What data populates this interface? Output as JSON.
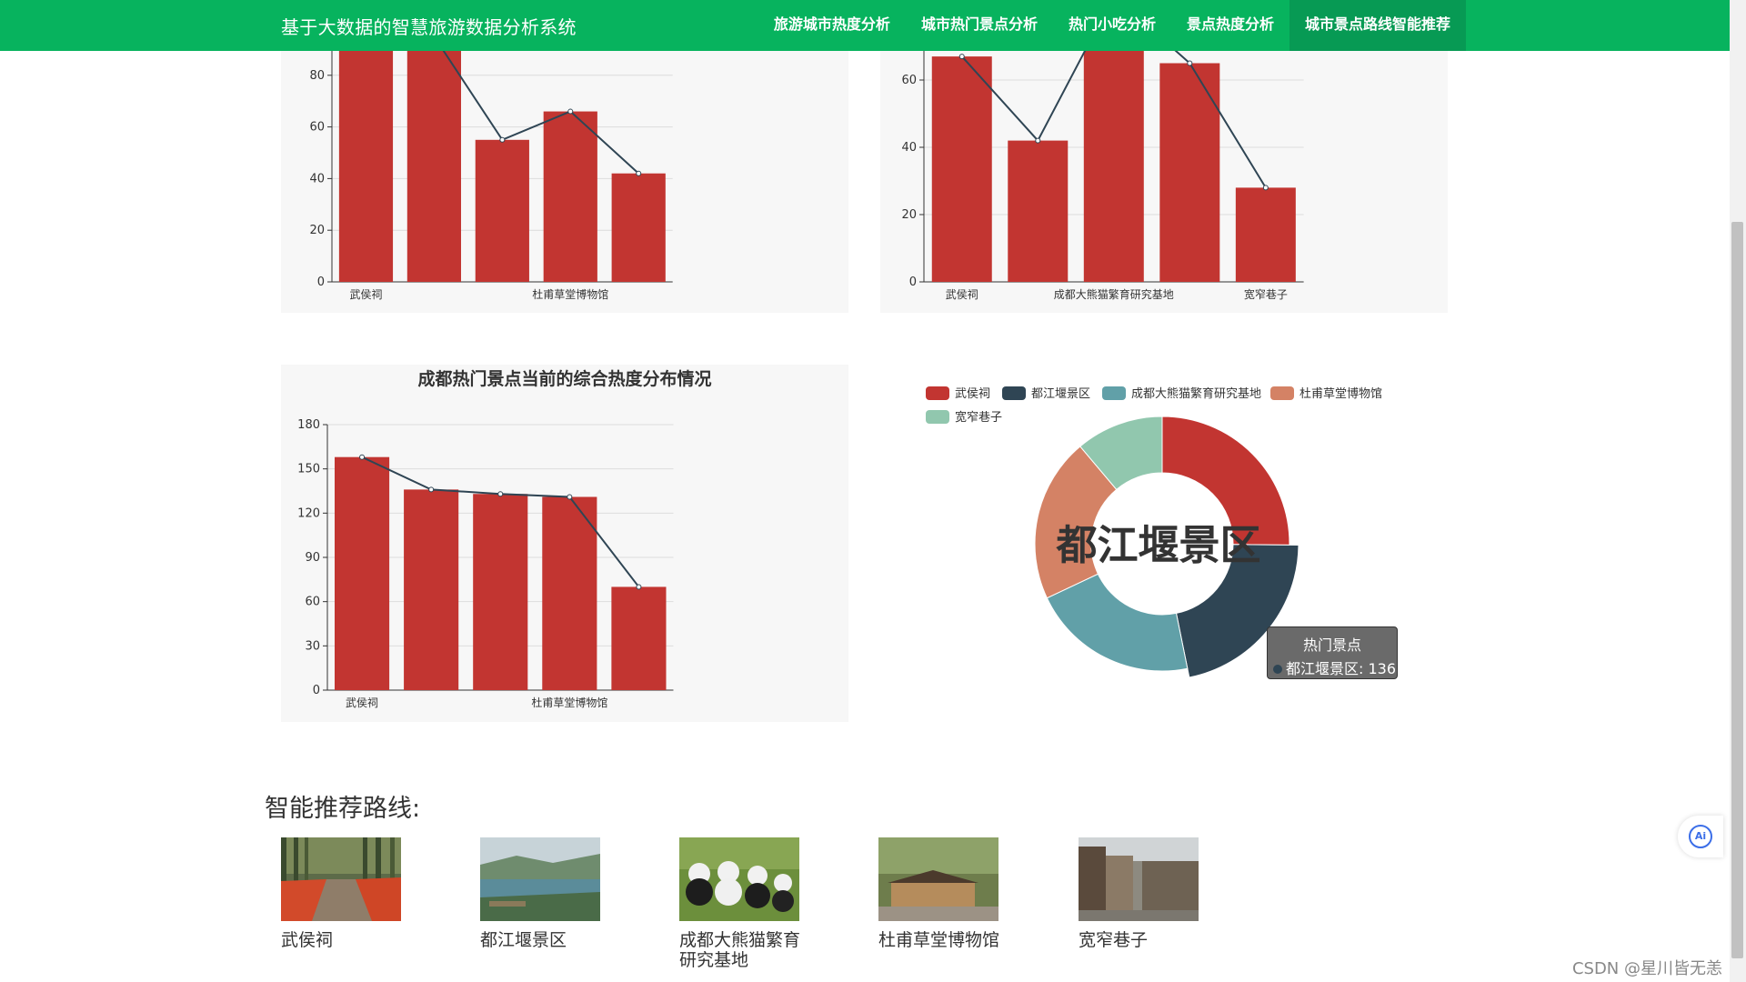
{
  "header": {
    "brand": "基于大数据的智慧旅游数据分析系统",
    "nav": [
      {
        "label": "旅游城市热度分析",
        "active": false
      },
      {
        "label": "城市热门景点分析",
        "active": false
      },
      {
        "label": "热门小吃分析",
        "active": false
      },
      {
        "label": "景点热度分析",
        "active": false
      },
      {
        "label": "城市景点路线智能推荐",
        "active": true
      }
    ]
  },
  "colors": {
    "bar": "#c23531",
    "line": "#2f4554",
    "nav_bg": "#07b35e",
    "pie": [
      "#c23531",
      "#2f4554",
      "#61a0a8",
      "#d48265",
      "#91c7ae"
    ]
  },
  "chart_data": [
    {
      "type": "bar",
      "title": "",
      "categories": [
        "武侯祠",
        "都江堰景区",
        "成都大熊猫繁育研究基地",
        "杜甫草堂博物馆",
        "宽窄巷子"
      ],
      "tick_labels": [
        "武侯祠",
        "",
        "",
        "杜甫草堂博物馆",
        ""
      ],
      "values": [
        90,
        90,
        55,
        66,
        42
      ],
      "line_values": [
        108,
        95,
        55,
        66,
        42
      ],
      "yticks": [
        0,
        20,
        40,
        60,
        80
      ],
      "ylim": [
        0,
        100
      ]
    },
    {
      "type": "bar",
      "title": "",
      "categories": [
        "武侯祠",
        "都江堰景区",
        "成都大熊猫繁育研究基地",
        "杜甫草堂博物馆",
        "宽窄巷子"
      ],
      "tick_labels": [
        "武侯祠",
        "",
        "成都大熊猫繁育研究基地",
        "",
        "宽窄巷子"
      ],
      "values": [
        67,
        42,
        80,
        65,
        28
      ],
      "line_values": [
        67,
        42,
        85,
        65,
        28
      ],
      "yticks": [
        0,
        20,
        40,
        60
      ],
      "ylim": [
        0,
        70
      ]
    },
    {
      "type": "bar",
      "title": "成都热门景点当前的综合热度分布情况",
      "categories": [
        "武侯祠",
        "都江堰景区",
        "成都大熊猫繁育研究基地",
        "杜甫草堂博物馆",
        "宽窄巷子"
      ],
      "tick_labels": [
        "武侯祠",
        "",
        "",
        "杜甫草堂博物馆",
        ""
      ],
      "values": [
        158,
        136,
        133,
        131,
        70
      ],
      "line_values": [
        158,
        136,
        133,
        131,
        70
      ],
      "yticks": [
        0,
        30,
        60,
        90,
        120,
        150,
        180
      ],
      "ylim": [
        0,
        180
      ]
    },
    {
      "type": "pie",
      "series_name": "热门景点",
      "center_label": "都江堰景区",
      "labels": [
        "武侯祠",
        "都江堰景区",
        "成都大熊猫繁育研究基地",
        "杜甫草堂博物馆",
        "宽窄巷子"
      ],
      "values": [
        158,
        136,
        133,
        131,
        70
      ],
      "highlight_index": 1,
      "tooltip": {
        "title": "热门景点",
        "text": "都江堰景区: 136"
      }
    }
  ],
  "routes": {
    "title": "智能推荐路线:",
    "items": [
      {
        "label": "武侯祠"
      },
      {
        "label": "都江堰景区"
      },
      {
        "label": "成都大熊猫繁育研究基地"
      },
      {
        "label": "杜甫草堂博物馆"
      },
      {
        "label": "宽窄巷子"
      }
    ]
  },
  "ai_button": {
    "label": "Ai"
  },
  "watermark": "CSDN @星川皆无恙"
}
